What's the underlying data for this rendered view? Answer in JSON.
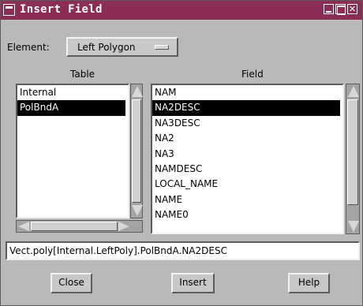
{
  "window": {
    "title": "Insert Field"
  },
  "element": {
    "label": "Element:",
    "selected": "Left Polygon"
  },
  "table": {
    "header": "Table",
    "items": [
      "Internal",
      "PolBndA"
    ],
    "selected_index": 1
  },
  "field": {
    "header": "Field",
    "items": [
      "NAM",
      "NA2DESC",
      "NA3DESC",
      "NA2",
      "NA3",
      "NAMDESC",
      "LOCAL_NAME",
      "NAME",
      "NAME0"
    ],
    "selected_index": 1
  },
  "expression": {
    "value": "Vect.poly[Internal.LeftPoly].PolBndA.NA2DESC"
  },
  "buttons": {
    "close": "Close",
    "insert": "Insert",
    "help": "Help"
  },
  "colors": {
    "titlebar": "#8c2d55",
    "window_bg": "#b9b9b9",
    "selection": "#000000"
  }
}
